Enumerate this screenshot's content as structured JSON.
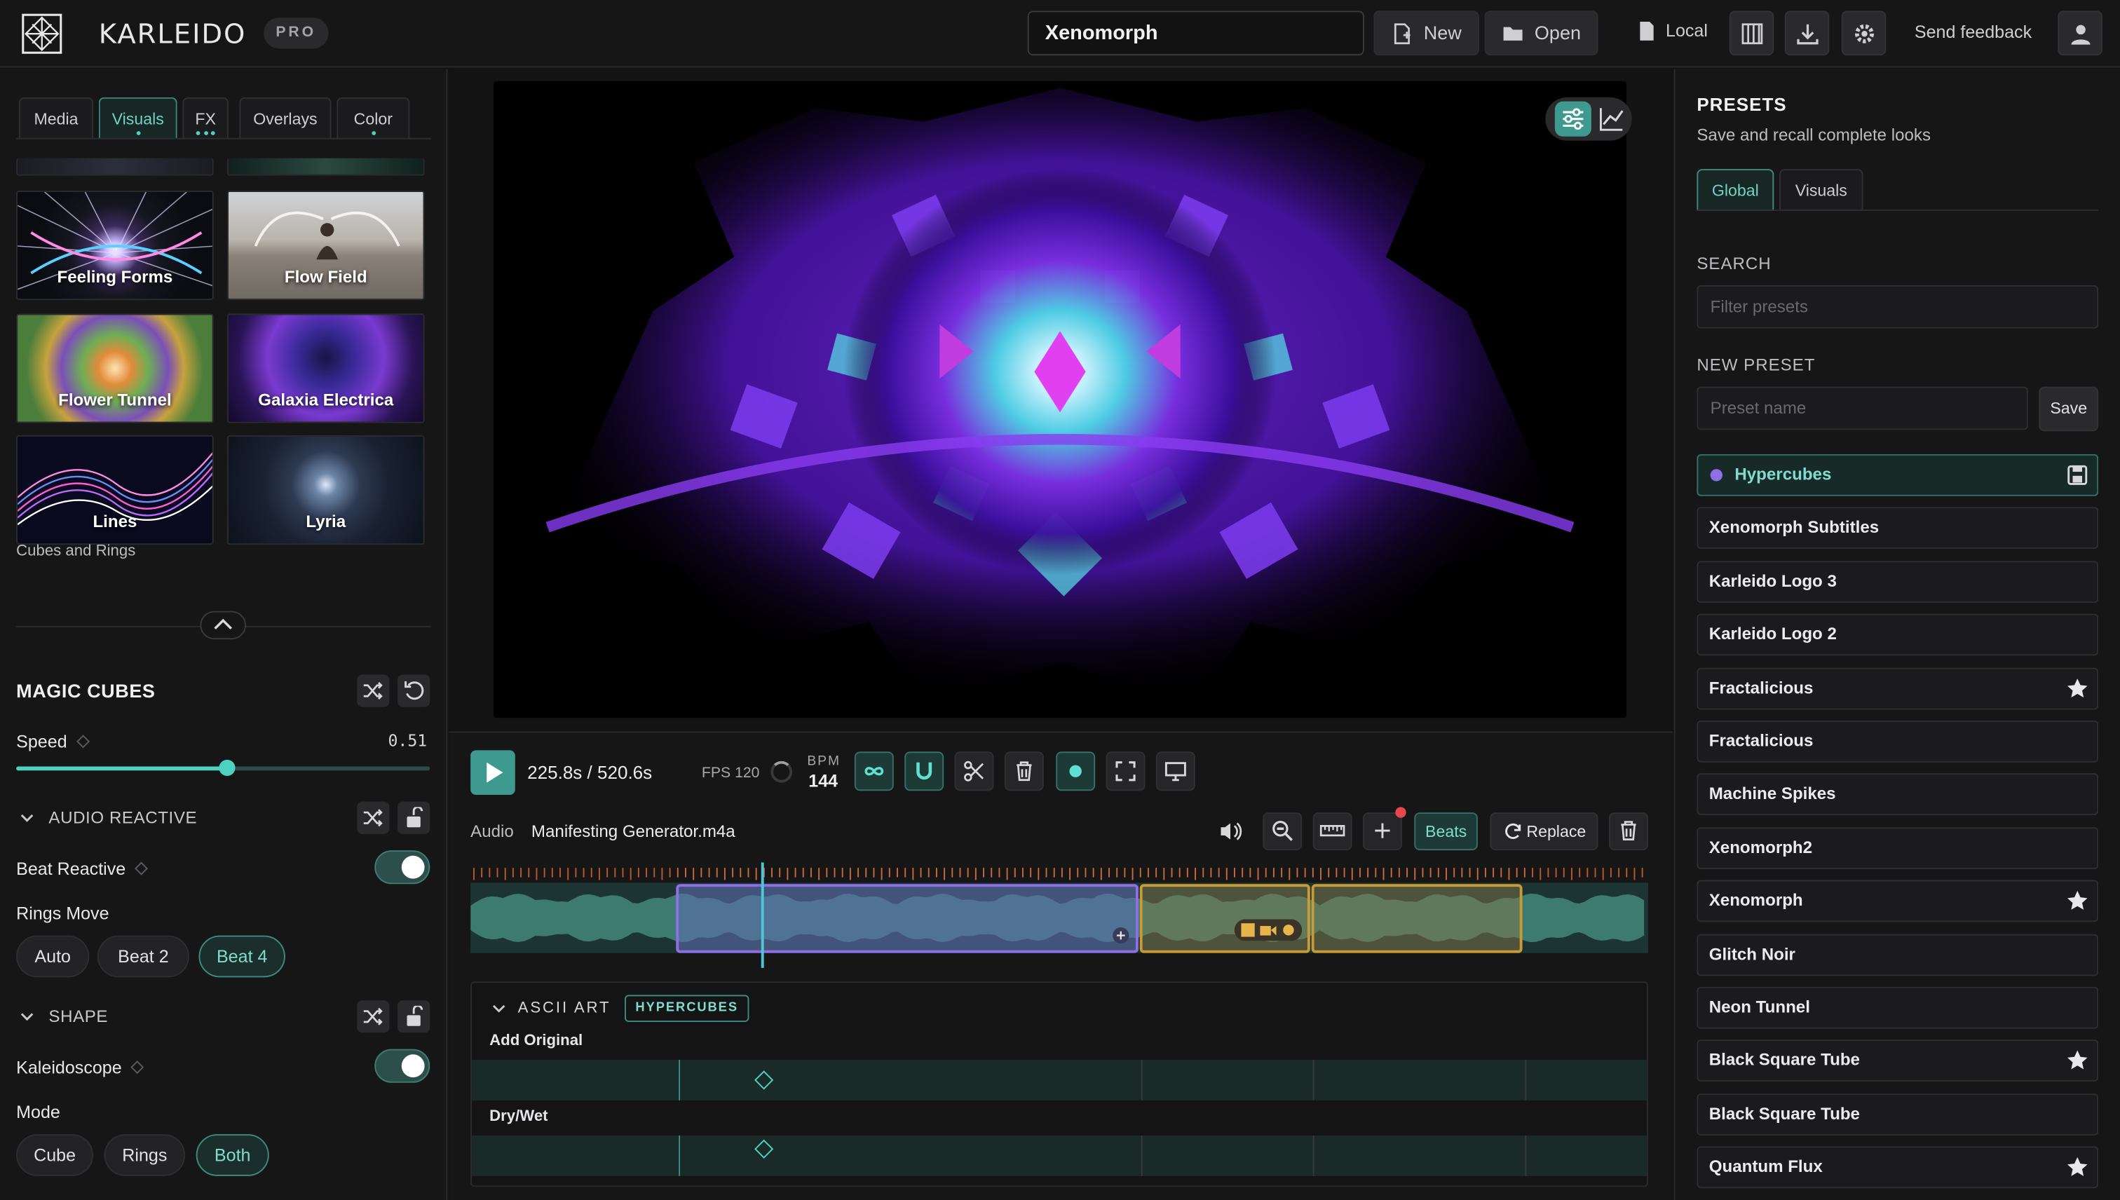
{
  "app": {
    "brand": "KARLEIDO",
    "badge": "PRO",
    "project_name": "Xenomorph",
    "new_label": "New",
    "open_label": "Open",
    "storage_label": "Local",
    "feedback_label": "Send feedback",
    "accent_color": "#4fd1c0"
  },
  "left": {
    "tabs": [
      "Media",
      "Visuals",
      "FX",
      "Overlays",
      "Color"
    ],
    "active_tab": "Visuals",
    "thumbnails": [
      {
        "label": "Feeling Forms"
      },
      {
        "label": "Flow Field"
      },
      {
        "label": "Flower Tunnel"
      },
      {
        "label": "Galaxia Electrica"
      },
      {
        "label": "Lines"
      },
      {
        "label": "Lyria"
      }
    ],
    "selected_caption": "Cubes and Rings",
    "section_title": "MAGIC CUBES",
    "speed_label": "Speed",
    "speed_value": "0.51",
    "speed_fraction": 0.51,
    "audio_reactive_title": "AUDIO REACTIVE",
    "beat_reactive_label": "Beat Reactive",
    "beat_reactive_on": true,
    "rings_move_label": "Rings Move",
    "rings_move_options": [
      "Auto",
      "Beat 2",
      "Beat 4"
    ],
    "rings_move_selected": "Beat 4",
    "shape_title": "SHAPE",
    "kaleidoscope_label": "Kaleidoscope",
    "kaleidoscope_on": true,
    "mode_label": "Mode",
    "mode_options": [
      "Cube",
      "Rings",
      "Both"
    ],
    "mode_selected": "Both"
  },
  "transport": {
    "time": "225.8s / 520.6s",
    "fps": "FPS 120",
    "bpm_label": "BPM",
    "bpm_value": "144",
    "audio_label": "Audio",
    "audio_file": "Manifesting Generator.m4a",
    "beats_label": "Beats",
    "replace_label": "Replace",
    "playhead_seconds": 225.8,
    "duration_seconds": 520.6
  },
  "timeline": {
    "lane_group_title": "ASCII ART",
    "lane_group_tag": "HYPERCUBES",
    "lanes": [
      "Add Original",
      "Dry/Wet"
    ]
  },
  "presets": {
    "title": "PRESETS",
    "subtitle": "Save and recall complete looks",
    "tabs": [
      "Global",
      "Visuals"
    ],
    "active_tab": "Global",
    "search_label": "SEARCH",
    "search_placeholder": "Filter presets",
    "new_preset_label": "NEW PRESET",
    "new_preset_placeholder": "Preset name",
    "save_label": "Save",
    "items": [
      {
        "name": "Hypercubes",
        "active": true,
        "starred": false
      },
      {
        "name": "Xenomorph Subtitles",
        "active": false,
        "starred": false
      },
      {
        "name": "Karleido Logo 3",
        "active": false,
        "starred": false
      },
      {
        "name": "Karleido Logo 2",
        "active": false,
        "starred": false
      },
      {
        "name": "Fractalicious",
        "active": false,
        "starred": true
      },
      {
        "name": "Fractalicious",
        "active": false,
        "starred": false
      },
      {
        "name": "Machine Spikes",
        "active": false,
        "starred": false
      },
      {
        "name": "Xenomorph2",
        "active": false,
        "starred": false
      },
      {
        "name": "Xenomorph",
        "active": false,
        "starred": true
      },
      {
        "name": "Glitch Noir",
        "active": false,
        "starred": false
      },
      {
        "name": "Neon Tunnel",
        "active": false,
        "starred": false
      },
      {
        "name": "Black Square Tube",
        "active": false,
        "starred": true
      },
      {
        "name": "Black Square Tube",
        "active": false,
        "starred": false
      },
      {
        "name": "Quantum Flux",
        "active": false,
        "starred": true
      }
    ]
  }
}
